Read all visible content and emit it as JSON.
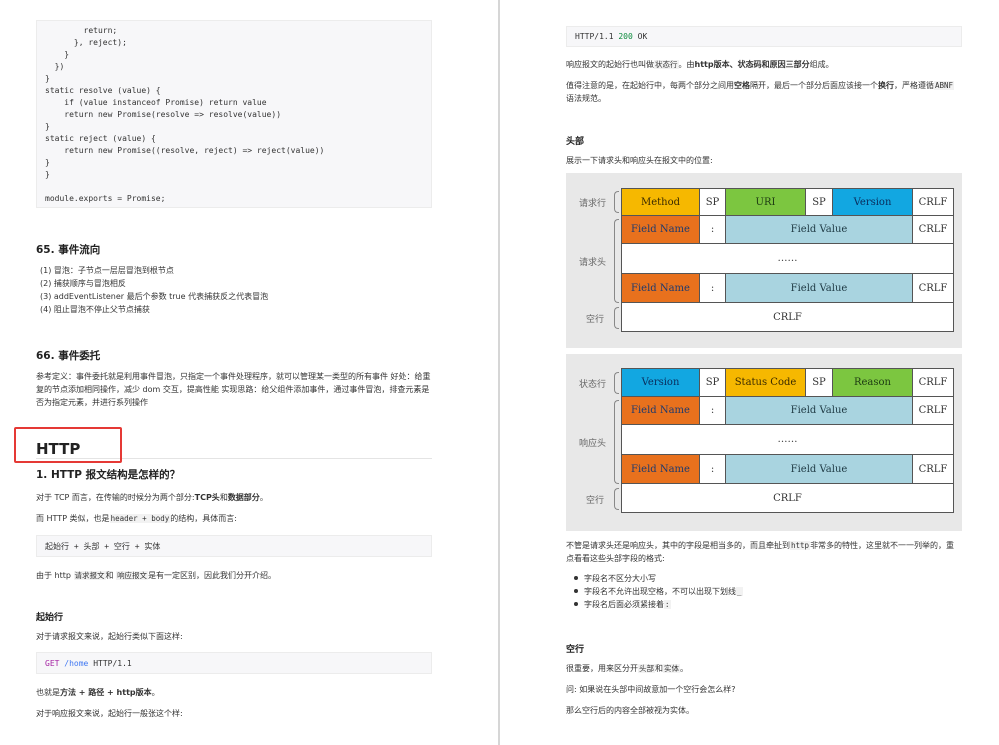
{
  "left": {
    "code_top": [
      "        return;",
      "      }, reject);",
      "    }",
      "  })",
      "}",
      "static resolve (value) {",
      "    if (value instanceof Promise) return value",
      "    return new Promise(resolve => resolve(value))",
      "}",
      "static reject (value) {",
      "    return new Promise((resolve, reject) => reject(value))",
      "}",
      "}",
      "",
      "module.exports = Promise;"
    ],
    "section65": {
      "title": "65. 事件流向",
      "items": [
        "(1) 冒泡：子节点一层层冒泡到根节点",
        "(2) 捕获顺序与冒泡相反",
        "(3) addEventListener 最后个参数 true 代表捕获反之代表冒泡",
        "(4) 阻止冒泡不停止父节点捕获"
      ]
    },
    "section66": {
      "title": "66. 事件委托",
      "body": "参考定义：事件委托就是利用事件冒泡，只指定一个事件处理程序，就可以管理某一类型的所有事件 好处：给重复的节点添加相同操作，减少 dom 交互，提高性能 实现思路：给父组件添加事件，通过事件冒泡，排查元素是否为指定元素，并进行系列操作"
    },
    "http_heading": "HTTP",
    "q1": {
      "title": "1. HTTP 报文结构是怎样的？",
      "p1_a": "对于 TCP 而言，在传输的时候分为两个部分:",
      "p1_b": "TCP头",
      "p1_c": "和",
      "p1_d": "数据部分",
      "p1_e": "。",
      "p2_a": "而 HTTP 类似，也是",
      "p2_code": "header + body",
      "p2_b": "的结构，具体而言:",
      "code_structure": "起始行 + 头部 + 空行 + 实体",
      "p3_a": "由于 http ",
      "p3_code1": "请求报文",
      "p3_b": "和 ",
      "p3_code2": "响应报文",
      "p3_c": "是有一定区别，因此我们分开介绍。"
    },
    "start_line": {
      "title": "起始行",
      "p1": "对于请求报文来说，起始行类似下面这样:",
      "code_get": "GET",
      "code_path": "/home",
      "code_ver": "HTTP/1.1",
      "p2_a": "也就是",
      "p2_b": "方法 + 路径 + http版本",
      "p2_c": "。",
      "p3": "对于响应报文来说，起始行一般张这个样:"
    }
  },
  "right": {
    "code_status": {
      "ver": "HTTP/1.1",
      "code": "200",
      "text": "OK"
    },
    "p1_a": "响应报文的起始行也叫做",
    "p1_code": "状态行",
    "p1_b": "。由",
    "p1_c": "http版本、状态码和原因三部分",
    "p1_d": "组成。",
    "p2_a": "值得注意的是，在起始行中，每两个部分之间用",
    "p2_b": "空格",
    "p2_c": "隔开，最后一个部分后面应该接一个",
    "p2_d": "换行",
    "p2_e": "，严格遵循",
    "p2_code": "ABNF",
    "p2_f": " 语法规范。",
    "headers_title": "头部",
    "headers_p": "展示一下请求头和响应头在报文中的位置:",
    "req_diagram": {
      "label_start": "请求行",
      "label_header": "请求头",
      "label_blank": "空行",
      "method": "Method",
      "sp": "SP",
      "uri": "URI",
      "version": "Version",
      "crlf": "CRLF",
      "field_name": "Field Name",
      "colon": ":",
      "field_value": "Field Value",
      "ellipsis": "……"
    },
    "resp_diagram": {
      "label_status": "状态行",
      "label_header": "响应头",
      "label_blank": "空行",
      "version": "Version",
      "sp": "SP",
      "status_code": "Status Code",
      "reason": "Reason",
      "crlf": "CRLF",
      "field_name": "Field Name",
      "colon": ":",
      "field_value": "Field Value",
      "ellipsis": "……"
    },
    "p3_a": "不管是请求头还是响应头，其中的字段是相当多的，而且牵扯到",
    "p3_code": "http",
    "p3_b": "非常多的特性，这里就不一一列举的，重点看看这些头部字段的格式:",
    "bullets": [
      "字段名不区分大小写",
      "字段名不允许出现空格，不可以出现下划线",
      "字段名后面必须紧接着"
    ],
    "bullet2_code": "_",
    "bullet3_code": ":",
    "blank_title": "空行",
    "blank_p1_a": "很重要，用来区分开",
    "blank_p1_code1": "头部",
    "blank_p1_b": "和",
    "blank_p1_code2": "实体",
    "blank_p1_c": "。",
    "blank_p2": "问: 如果说在头部中间故意加一个空行会怎么样?",
    "blank_p3": "那么空行后的内容全部被视为实体。"
  }
}
